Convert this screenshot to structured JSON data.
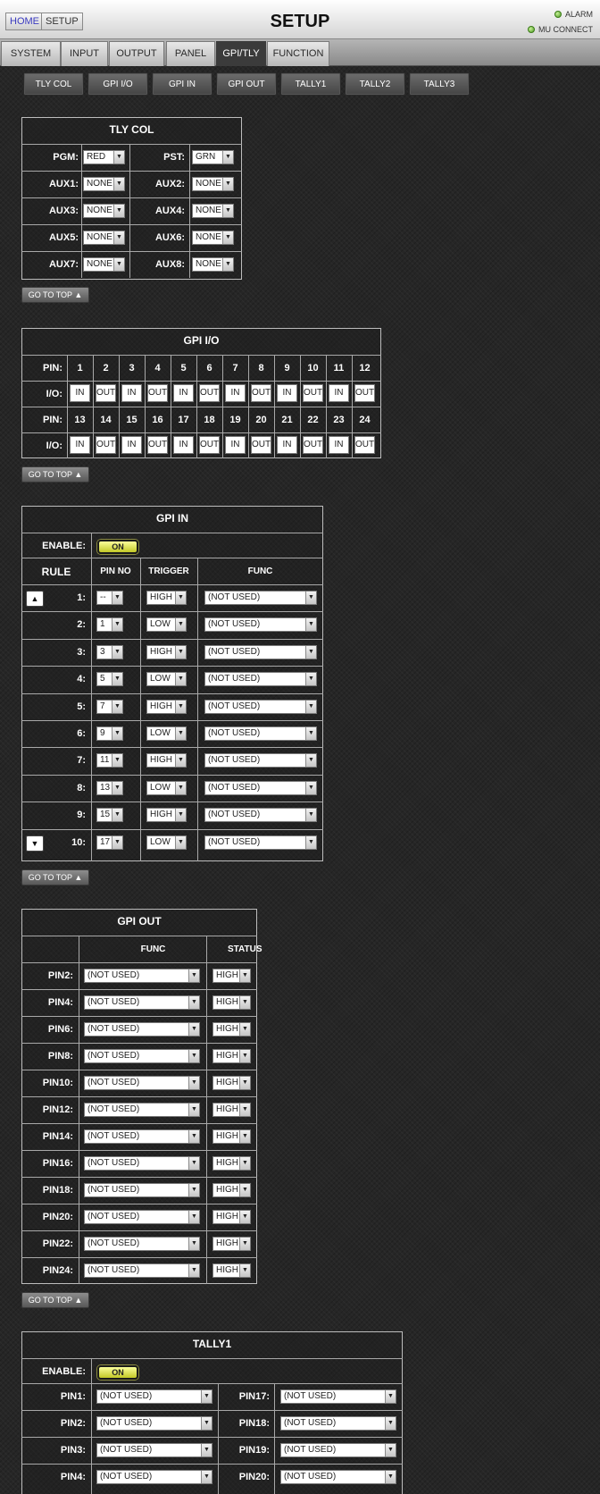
{
  "header": {
    "home": "HOME",
    "setup": "SETUP",
    "title": "SETUP",
    "alarm": "ALARM",
    "mu_connect": "MU CONNECT"
  },
  "tabs": [
    "SYSTEM",
    "INPUT",
    "OUTPUT",
    "PANEL",
    "GPI/TLY",
    "FUNCTION"
  ],
  "active_tab": "GPI/TLY",
  "subtabs": [
    "TLY COL",
    "GPI I/O",
    "GPI IN",
    "GPI OUT",
    "TALLY1",
    "TALLY2",
    "TALLY3"
  ],
  "go_to_top": "GO TO TOP ▲",
  "tly_col": {
    "title": "TLY COL",
    "rows": [
      {
        "l": "PGM:",
        "lv": "RED",
        "r": "PST:",
        "rv": "GRN"
      },
      {
        "l": "AUX1:",
        "lv": "NONE",
        "r": "AUX2:",
        "rv": "NONE"
      },
      {
        "l": "AUX3:",
        "lv": "NONE",
        "r": "AUX4:",
        "rv": "NONE"
      },
      {
        "l": "AUX5:",
        "lv": "NONE",
        "r": "AUX6:",
        "rv": "NONE"
      },
      {
        "l": "AUX7:",
        "lv": "NONE",
        "r": "AUX8:",
        "rv": "NONE"
      }
    ]
  },
  "gpi_io": {
    "title": "GPI I/O",
    "pin_label": "PIN:",
    "io_label": "I/O:",
    "row1_pins": [
      "1",
      "2",
      "3",
      "4",
      "5",
      "6",
      "7",
      "8",
      "9",
      "10",
      "11",
      "12"
    ],
    "row1_io": [
      "IN",
      "OUT",
      "IN",
      "OUT",
      "IN",
      "OUT",
      "IN",
      "OUT",
      "IN",
      "OUT",
      "IN",
      "OUT"
    ],
    "row2_pins": [
      "13",
      "14",
      "15",
      "16",
      "17",
      "18",
      "19",
      "20",
      "21",
      "22",
      "23",
      "24"
    ],
    "row2_io": [
      "IN",
      "OUT",
      "IN",
      "OUT",
      "IN",
      "OUT",
      "IN",
      "OUT",
      "IN",
      "OUT",
      "IN",
      "OUT"
    ]
  },
  "gpi_in": {
    "title": "GPI IN",
    "enable_label": "ENABLE:",
    "enable_value": "ON",
    "headers": [
      "RULE",
      "PIN NO",
      "TRIGGER",
      "FUNC"
    ],
    "rows": [
      {
        "rule": "1:",
        "pin": "--",
        "trig": "HIGH",
        "func": "(NOT USED)"
      },
      {
        "rule": "2:",
        "pin": "1",
        "trig": "LOW",
        "func": "(NOT USED)"
      },
      {
        "rule": "3:",
        "pin": "3",
        "trig": "HIGH",
        "func": "(NOT USED)"
      },
      {
        "rule": "4:",
        "pin": "5",
        "trig": "LOW",
        "func": "(NOT USED)"
      },
      {
        "rule": "5:",
        "pin": "7",
        "trig": "HIGH",
        "func": "(NOT USED)"
      },
      {
        "rule": "6:",
        "pin": "9",
        "trig": "LOW",
        "func": "(NOT USED)"
      },
      {
        "rule": "7:",
        "pin": "11",
        "trig": "HIGH",
        "func": "(NOT USED)"
      },
      {
        "rule": "8:",
        "pin": "13",
        "trig": "LOW",
        "func": "(NOT USED)"
      },
      {
        "rule": "9:",
        "pin": "15",
        "trig": "HIGH",
        "func": "(NOT USED)"
      },
      {
        "rule": "10:",
        "pin": "17",
        "trig": "LOW",
        "func": "(NOT USED)"
      }
    ]
  },
  "gpi_out": {
    "title": "GPI OUT",
    "headers": [
      "FUNC",
      "STATUS"
    ],
    "rows": [
      {
        "pin": "PIN2:",
        "func": "(NOT USED)",
        "status": "HIGH"
      },
      {
        "pin": "PIN4:",
        "func": "(NOT USED)",
        "status": "HIGH"
      },
      {
        "pin": "PIN6:",
        "func": "(NOT USED)",
        "status": "HIGH"
      },
      {
        "pin": "PIN8:",
        "func": "(NOT USED)",
        "status": "HIGH"
      },
      {
        "pin": "PIN10:",
        "func": "(NOT USED)",
        "status": "HIGH"
      },
      {
        "pin": "PIN12:",
        "func": "(NOT USED)",
        "status": "HIGH"
      },
      {
        "pin": "PIN14:",
        "func": "(NOT USED)",
        "status": "HIGH"
      },
      {
        "pin": "PIN16:",
        "func": "(NOT USED)",
        "status": "HIGH"
      },
      {
        "pin": "PIN18:",
        "func": "(NOT USED)",
        "status": "HIGH"
      },
      {
        "pin": "PIN20:",
        "func": "(NOT USED)",
        "status": "HIGH"
      },
      {
        "pin": "PIN22:",
        "func": "(NOT USED)",
        "status": "HIGH"
      },
      {
        "pin": "PIN24:",
        "func": "(NOT USED)",
        "status": "HIGH"
      }
    ]
  },
  "tally1": {
    "title": "TALLY1",
    "enable_label": "ENABLE:",
    "enable_value": "ON",
    "rows": [
      {
        "l": "PIN1:",
        "lv": "(NOT USED)",
        "r": "PIN17:",
        "rv": "(NOT USED)"
      },
      {
        "l": "PIN2:",
        "lv": "(NOT USED)",
        "r": "PIN18:",
        "rv": "(NOT USED)"
      },
      {
        "l": "PIN3:",
        "lv": "(NOT USED)",
        "r": "PIN19:",
        "rv": "(NOT USED)"
      },
      {
        "l": "PIN4:",
        "lv": "(NOT USED)",
        "r": "PIN20:",
        "rv": "(NOT USED)"
      }
    ]
  }
}
